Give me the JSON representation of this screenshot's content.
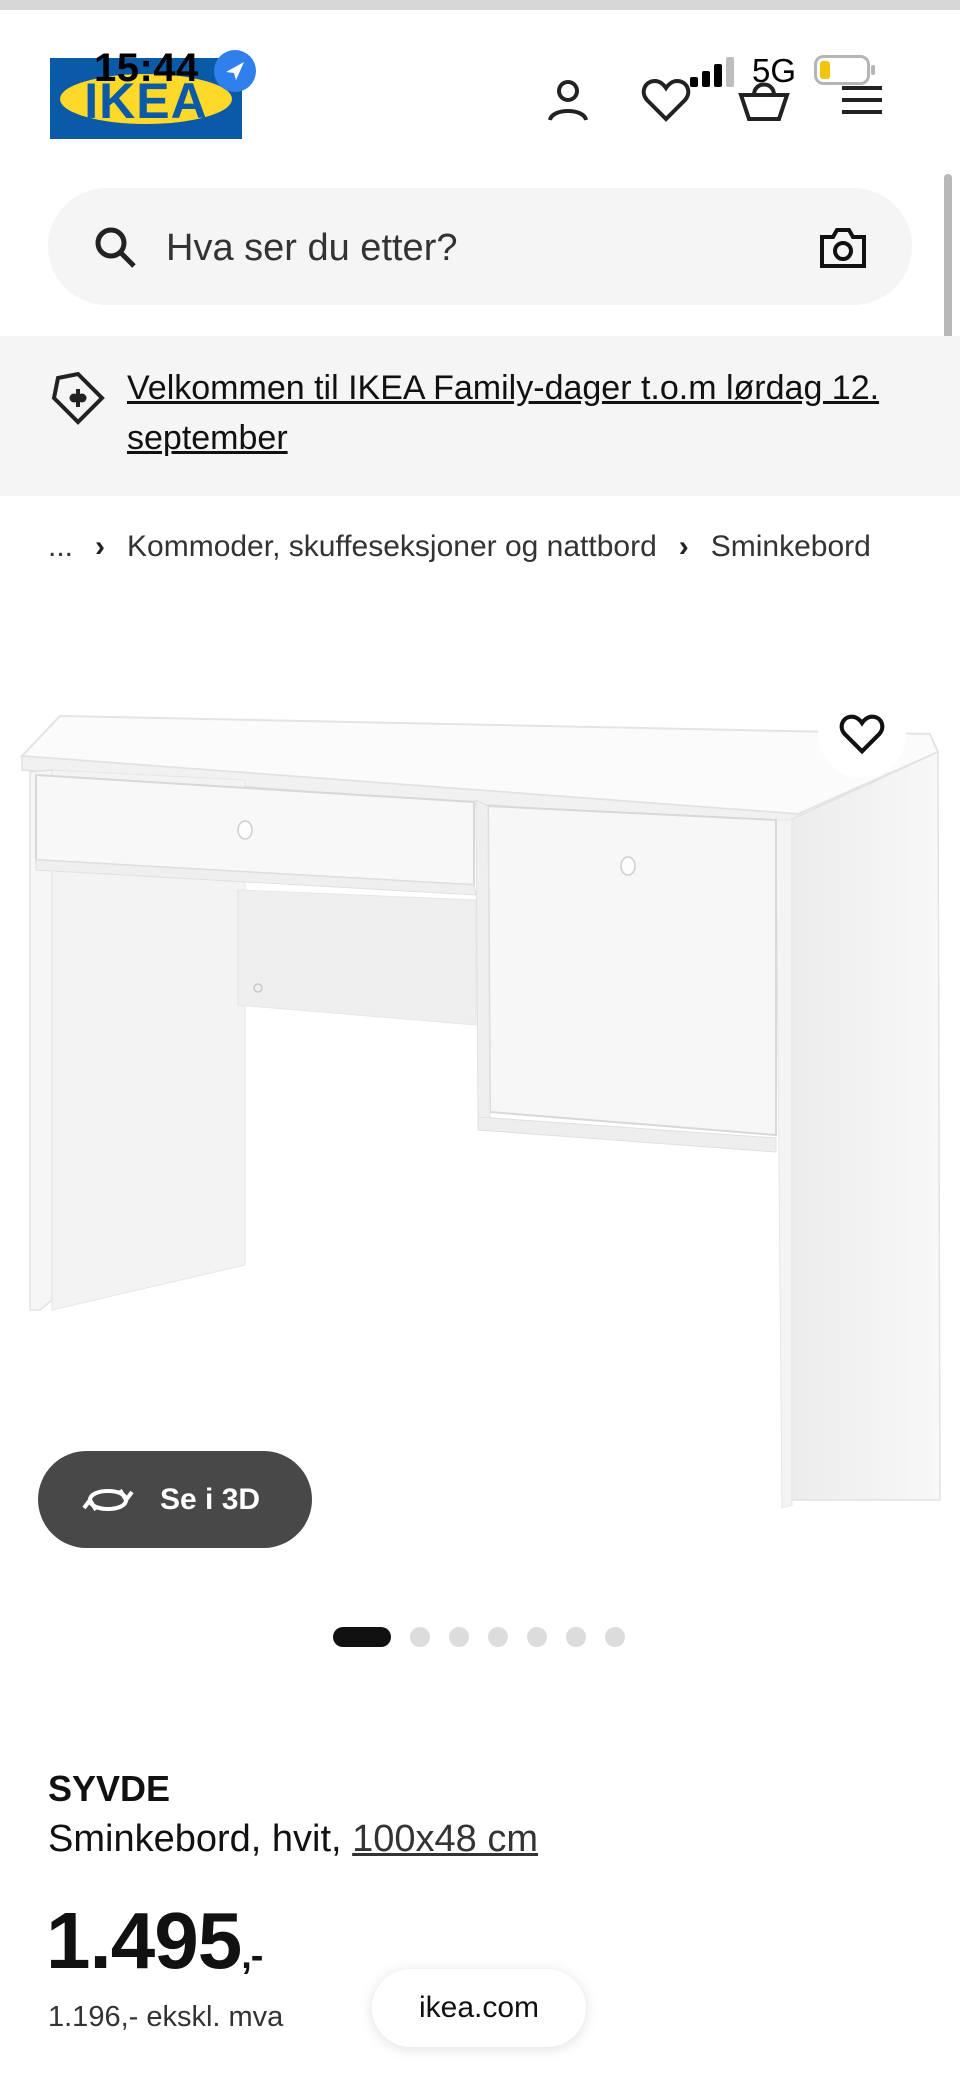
{
  "status_bar": {
    "time": "15:44",
    "network": "5G"
  },
  "header": {
    "logo_text": "IKEA",
    "icons": [
      "profile-icon",
      "heart-icon",
      "basket-icon",
      "menu-icon"
    ]
  },
  "search": {
    "placeholder": "Hva ser du etter?"
  },
  "promo": {
    "text": "Velkommen til IKEA Family-dager t.o.m lørdag 12. september"
  },
  "breadcrumb": {
    "items": [
      "...",
      "Kommoder, skuffeseksjoner og nattbord",
      "Sminkebord"
    ]
  },
  "gallery": {
    "view_3d_label": "Se i 3D",
    "dot_count": 7,
    "active_index": 0
  },
  "product": {
    "name": "SYVDE",
    "description": "Sminkebord, hvit,",
    "size": "100x48 cm",
    "price": "1.495",
    "price_suffix": ",-",
    "price_ex_vat": "1.196,- ekskl. mva"
  },
  "browser": {
    "url": "ikea.com"
  },
  "colors": {
    "brand_blue": "#0a5aa8",
    "brand_yellow": "#ffd92a",
    "button_dark": "#484848"
  }
}
